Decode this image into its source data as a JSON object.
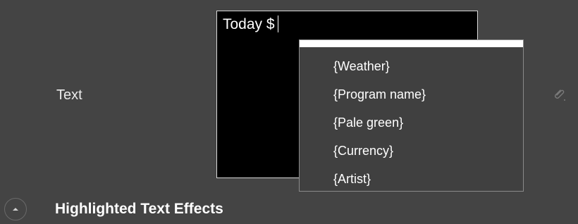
{
  "property": {
    "label": "Text"
  },
  "editor": {
    "value": "Today $"
  },
  "suggestions": [
    {
      "label": "{Weather}"
    },
    {
      "label": "{Program name}"
    },
    {
      "label": "{Pale green}"
    },
    {
      "label": "{Currency}"
    },
    {
      "label": "{Artist}"
    }
  ],
  "section": {
    "title": "Highlighted Text Effects",
    "toggle_icon": "chevron-up-icon"
  },
  "icons": {
    "attach": "paperclip-icon"
  },
  "colors": {
    "background": "#444444",
    "editor_background": "#000000",
    "dropdown_background": "#404040",
    "text": "#ffffff"
  }
}
